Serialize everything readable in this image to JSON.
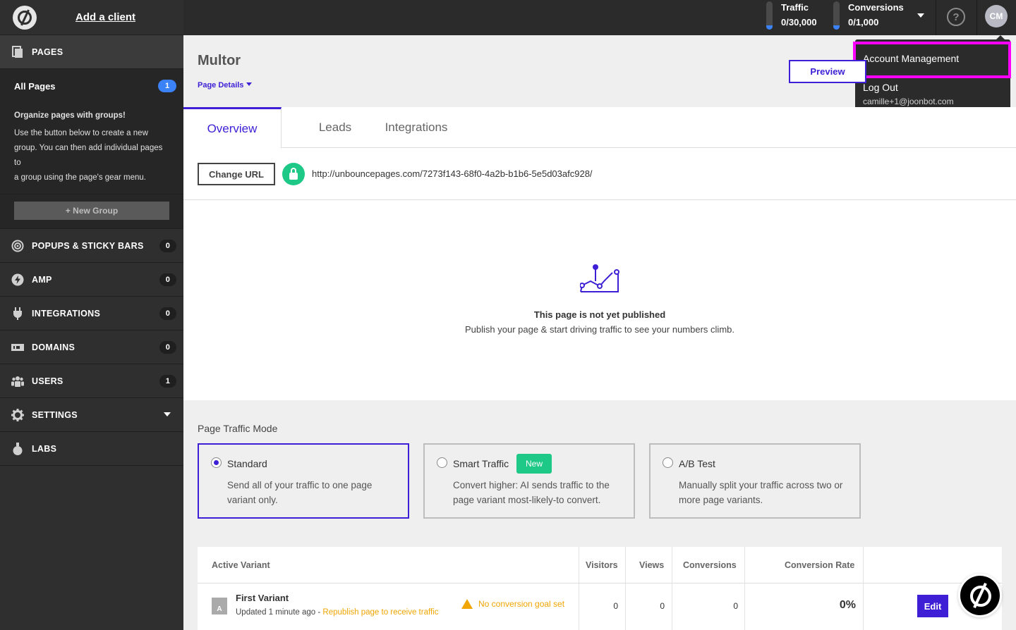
{
  "sidebar": {
    "add_client": "Add a client",
    "pages_label": "PAGES",
    "all_pages_label": "All Pages",
    "all_pages_count": "1",
    "groups_heading": "Organize pages with groups!",
    "groups_line1": "Use the button below to create a new",
    "groups_line2": "group. You can then add individual pages to",
    "groups_line3": "a group using the page's gear menu.",
    "new_group": "+ New Group",
    "items": [
      {
        "label": "POPUPS & STICKY BARS",
        "count": "0"
      },
      {
        "label": "AMP",
        "count": "0"
      },
      {
        "label": "INTEGRATIONS",
        "count": "0"
      },
      {
        "label": "DOMAINS",
        "count": "0"
      },
      {
        "label": "USERS",
        "count": "1"
      },
      {
        "label": "SETTINGS"
      },
      {
        "label": "LABS"
      }
    ]
  },
  "topbar": {
    "traffic_label": "Traffic",
    "traffic_value": "0/30,000",
    "conversions_label": "Conversions",
    "conversions_value": "0/1,000",
    "help": "?",
    "avatar": "CM"
  },
  "dropdown": {
    "account_management": "Account Management",
    "log_out": "Log Out",
    "email": "camille+1@joonbot.com"
  },
  "page": {
    "title": "Multor",
    "details": "Page Details",
    "preview": "Preview",
    "tabs": [
      {
        "label": "Overview"
      },
      {
        "label": "Leads"
      },
      {
        "label": "Integrations"
      }
    ],
    "change_url": "Change URL",
    "url": "http://unbouncepages.com/7273f143-68f0-4a2b-b1b6-5e5d03afc928/",
    "empty_title": "This page is not yet published",
    "empty_text": "Publish your page & start driving traffic to see your numbers climb."
  },
  "traffic_mode": {
    "label": "Page Traffic Mode",
    "modes": [
      {
        "title": "Standard",
        "desc": "Send all of your traffic to one page variant only."
      },
      {
        "title": "Smart Traffic",
        "badge": "New",
        "desc": "Convert higher: AI sends traffic to the page variant most-likely-to convert."
      },
      {
        "title": "A/B Test",
        "desc": "Manually split your traffic across two or more page variants."
      }
    ]
  },
  "variants": {
    "headers": {
      "active_variant": "Active Variant",
      "visitors": "Visitors",
      "views": "Views",
      "conversions": "Conversions",
      "conversion_rate": "Conversion Rate"
    },
    "rows": [
      {
        "badge": "A",
        "name": "First Variant",
        "updated": "Updated 1 minute ago - ",
        "republish": "Republish page to receive traffic",
        "warning": "No conversion goal set",
        "visitors": "0",
        "views": "0",
        "conversions": "0",
        "rate": "0%",
        "edit": "Edit"
      }
    ]
  },
  "colors": {
    "accent": "#3e1fd6",
    "highlight": "#ff00ff",
    "success": "#1ec887",
    "warning": "#f0a500",
    "badge_blue": "#3b82f6"
  }
}
